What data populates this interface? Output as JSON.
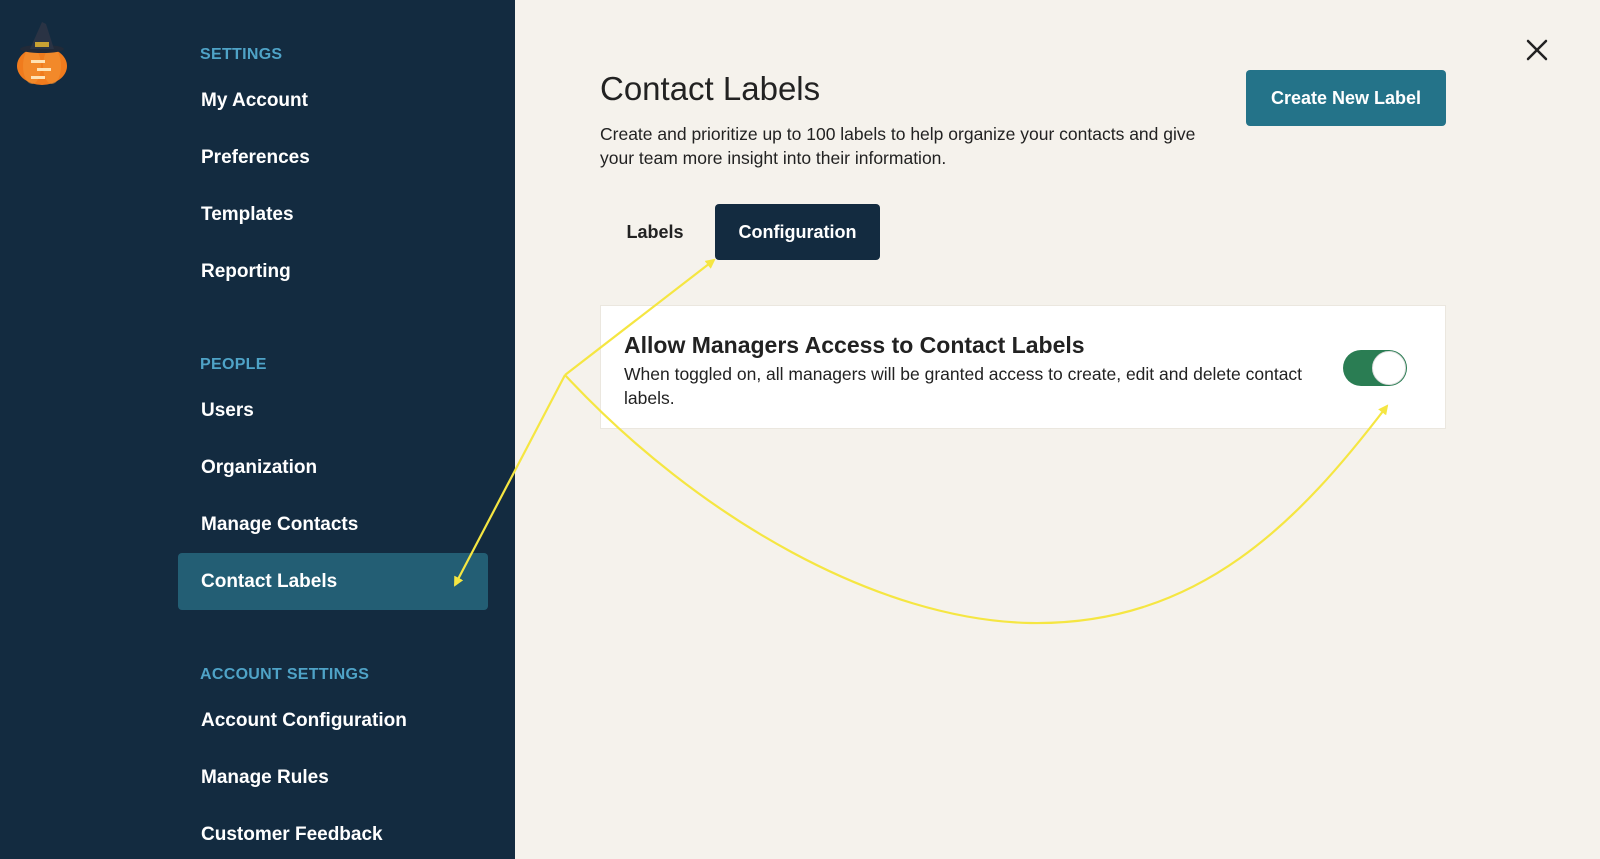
{
  "sidebar": {
    "sections": [
      {
        "header": "SETTINGS",
        "items": [
          "My Account",
          "Preferences",
          "Templates",
          "Reporting"
        ]
      },
      {
        "header": "PEOPLE",
        "items": [
          "Users",
          "Organization",
          "Manage Contacts",
          "Contact Labels"
        ]
      },
      {
        "header": "ACCOUNT SETTINGS",
        "items": [
          "Account Configuration",
          "Manage Rules",
          "Customer Feedback"
        ]
      }
    ],
    "active_item": "Contact Labels"
  },
  "main": {
    "title": "Contact Labels",
    "subtitle": "Create and prioritize up to 100 labels to help organize your contacts and give your team more insight into their information.",
    "create_button": "Create New Label",
    "tabs": [
      {
        "label": "Labels",
        "active": false
      },
      {
        "label": "Configuration",
        "active": true
      }
    ],
    "setting": {
      "title": "Allow Managers Access to Contact Labels",
      "description": "When toggled on, all managers will be granted access to create, edit and delete contact labels.",
      "enabled": true
    }
  },
  "colors": {
    "sidebar_bg": "#132b40",
    "section_header": "#4fa3c7",
    "active_item_bg": "#235e74",
    "primary_button": "#247389",
    "toggle_on": "#2a7d53",
    "annotation": "#f5e642"
  },
  "icons": {
    "logo": "pumpkin-witch-logo-icon",
    "close": "close-icon"
  }
}
